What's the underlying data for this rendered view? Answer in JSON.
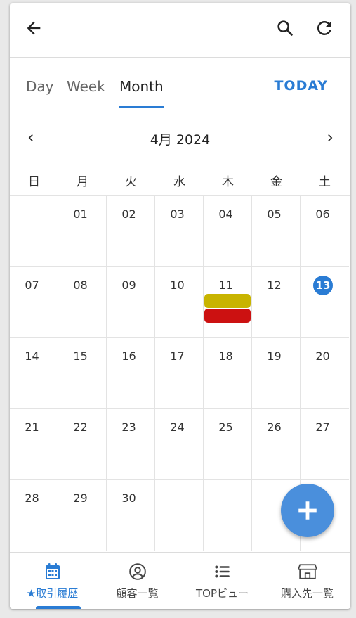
{
  "views": {
    "day": "Day",
    "week": "Week",
    "month": "Month",
    "today": "TODAY"
  },
  "calendar": {
    "month_title": "4月 2024",
    "weekdays": [
      "日",
      "月",
      "火",
      "水",
      "木",
      "金",
      "土"
    ],
    "weeks": [
      [
        "",
        "01",
        "02",
        "03",
        "04",
        "05",
        "06"
      ],
      [
        "07",
        "08",
        "09",
        "10",
        "11",
        "12",
        "13"
      ],
      [
        "14",
        "15",
        "16",
        "17",
        "18",
        "19",
        "20"
      ],
      [
        "21",
        "22",
        "23",
        "24",
        "25",
        "26",
        "27"
      ],
      [
        "28",
        "29",
        "30",
        "",
        "",
        "",
        ""
      ]
    ],
    "today": "13",
    "events": [
      {
        "day": "11",
        "color": "#c8b400"
      },
      {
        "day": "11",
        "color": "#cc1111"
      }
    ]
  },
  "bottom_nav": [
    {
      "label": "★取引履歴",
      "icon": "calendar-icon",
      "active": true
    },
    {
      "label": "顧客一覧",
      "icon": "user-circle-icon",
      "active": false
    },
    {
      "label": "TOPビュー",
      "icon": "list-icon",
      "active": false
    },
    {
      "label": "購入先一覧",
      "icon": "store-icon",
      "active": false
    }
  ],
  "colors": {
    "accent": "#2a7cd4",
    "fab": "#4a8fdc"
  }
}
